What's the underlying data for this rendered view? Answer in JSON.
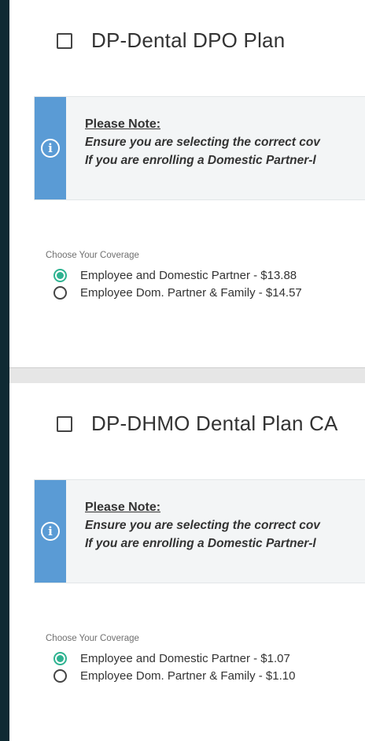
{
  "plans": [
    {
      "title": "DP-Dental DPO Plan",
      "notice": {
        "heading": "Please Note:",
        "line1": "Ensure you are selecting the correct cov",
        "line2": "If you are enrolling a Domestic Partner-l"
      },
      "coverage_label": "Choose Your Coverage",
      "options": [
        {
          "label": "Employee and Domestic Partner - $13.88",
          "selected": true
        },
        {
          "label": "Employee Dom. Partner & Family - $14.57",
          "selected": false
        }
      ]
    },
    {
      "title": "DP-DHMO Dental Plan CA",
      "notice": {
        "heading": "Please Note:",
        "line1": "Ensure you are selecting the correct cov",
        "line2": "If you are enrolling a Domestic Partner-l"
      },
      "coverage_label": "Choose Your Coverage",
      "options": [
        {
          "label": "Employee and Domestic Partner - $1.07",
          "selected": true
        },
        {
          "label": "Employee Dom. Partner & Family - $1.10",
          "selected": false
        }
      ]
    }
  ],
  "icons": {
    "notice": "info-icon",
    "unchecked": "checkbox-icon"
  },
  "colors": {
    "background": "#0f2a33",
    "accent_blue": "#5a9bd5",
    "radio_green": "#2fb391"
  }
}
